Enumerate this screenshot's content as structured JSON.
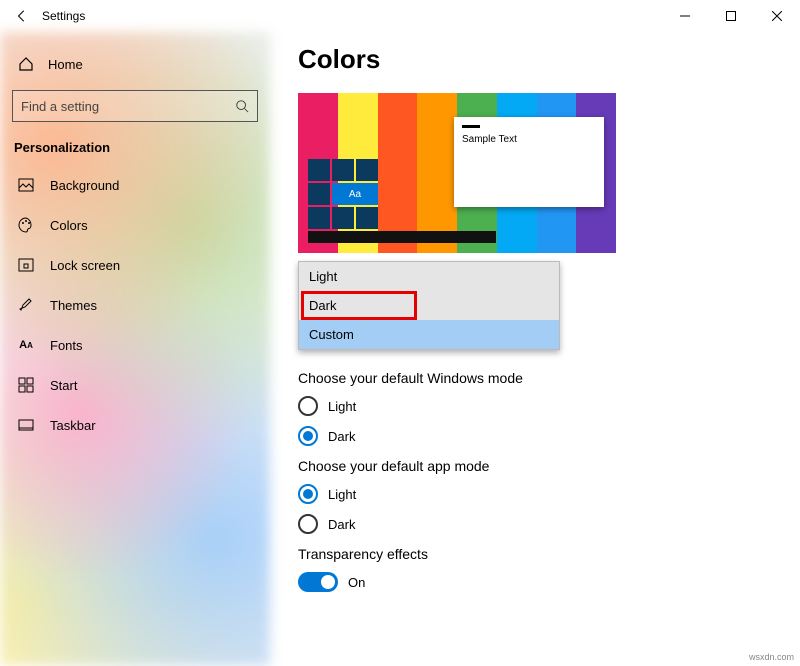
{
  "window": {
    "title": "Settings"
  },
  "sidebar": {
    "home_label": "Home",
    "search_placeholder": "Find a setting",
    "section": "Personalization",
    "items": [
      {
        "label": "Background",
        "icon": "image-icon"
      },
      {
        "label": "Colors",
        "icon": "palette-icon"
      },
      {
        "label": "Lock screen",
        "icon": "lockscreen-icon"
      },
      {
        "label": "Themes",
        "icon": "brush-icon"
      },
      {
        "label": "Fonts",
        "icon": "font-icon"
      },
      {
        "label": "Start",
        "icon": "start-icon"
      },
      {
        "label": "Taskbar",
        "icon": "taskbar-icon"
      }
    ]
  },
  "content": {
    "heading": "Colors",
    "preview": {
      "sample_text": "Sample Text",
      "tile_label": "Aa"
    },
    "color_dropdown": {
      "options": [
        "Light",
        "Dark",
        "Custom"
      ],
      "highlighted": "Dark",
      "selected": "Custom"
    },
    "windows_mode": {
      "label": "Choose your default Windows mode",
      "options": [
        "Light",
        "Dark"
      ],
      "selected": "Dark"
    },
    "app_mode": {
      "label": "Choose your default app mode",
      "options": [
        "Light",
        "Dark"
      ],
      "selected": "Light"
    },
    "transparency": {
      "label": "Transparency effects",
      "value_label": "On",
      "on": true
    }
  },
  "watermark": "wsxdn.com"
}
